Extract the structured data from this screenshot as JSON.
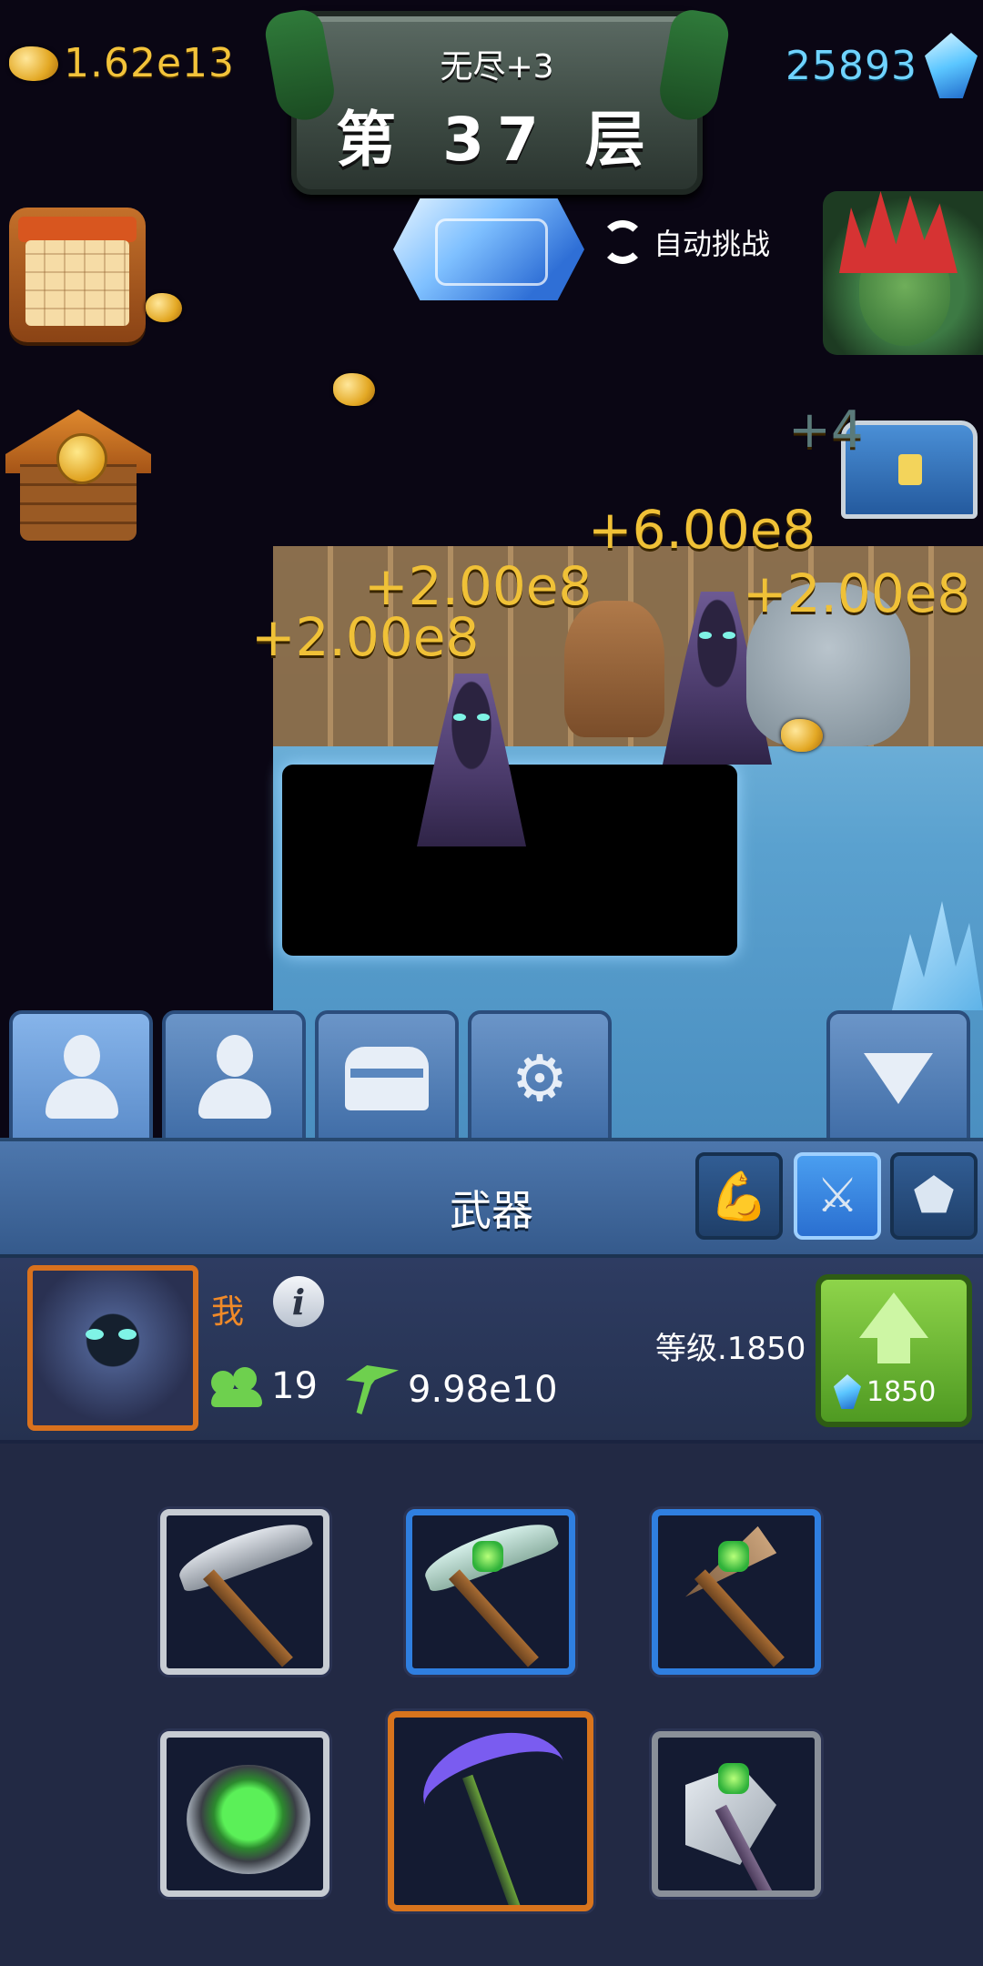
{
  "hud": {
    "gold": "1.62e13",
    "gems": "25893",
    "mode": "无尽+3",
    "floor": "第 37 层",
    "auto_challenge": "自动挑战"
  },
  "scene": {
    "damage_popups": [
      "+2.00e8",
      "+2.00e8",
      "+6.00e8",
      "+2.00e8"
    ],
    "faint_popup": "+4"
  },
  "tabs": [
    {
      "icon": "hero-silhouette-icon",
      "active": true
    },
    {
      "icon": "team-silhouette-icon"
    },
    {
      "icon": "chest-icon"
    },
    {
      "icon": "gear-icon"
    }
  ],
  "panel": {
    "title": "武器",
    "sub_tabs": [
      {
        "icon": "muscle-icon",
        "active": false
      },
      {
        "icon": "crossed-swords-icon",
        "active": true
      },
      {
        "icon": "ore-icon",
        "active": false
      }
    ]
  },
  "character": {
    "name": "我",
    "info": "i",
    "followers": "19",
    "mining_power": "9.98e10",
    "level_label": "等级.1850",
    "upgrade_cost": "1850"
  },
  "weapons": [
    {
      "name": "iron-pickaxe-icon",
      "rarity": "common"
    },
    {
      "name": "emerald-pickaxe-icon",
      "rarity": "rare"
    },
    {
      "name": "emerald-drill-icon",
      "rarity": "rare"
    },
    {
      "name": "emerald-ring-icon",
      "rarity": "common"
    },
    {
      "name": "void-scythe-icon",
      "rarity": "epic",
      "equipped": true
    },
    {
      "name": "emerald-axe-icon",
      "rarity": "uncommon"
    }
  ],
  "colors": {
    "gold_text": "#f3c33a",
    "gem_text": "#6fd3ff",
    "damage_text": "#f0c137",
    "name_orange": "#f08a28",
    "upgrade_green": "#6fb63a",
    "rare_border": "#2f7fe0",
    "epic_border": "#d8741d"
  }
}
